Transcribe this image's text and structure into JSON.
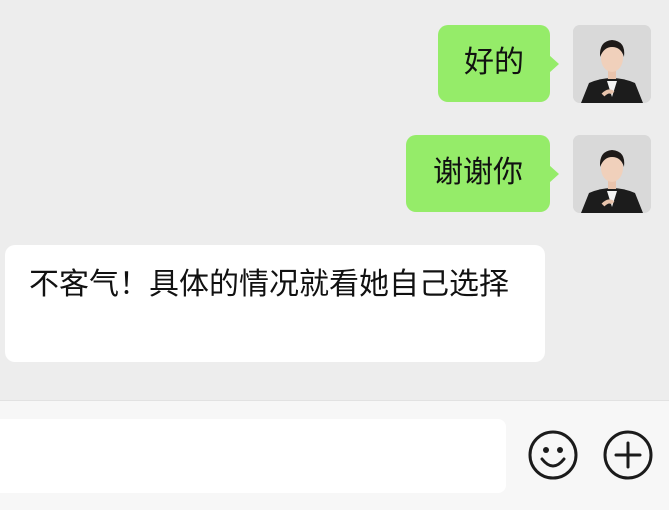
{
  "conversation": {
    "messages": [
      {
        "direction": "outgoing",
        "text": "好的"
      },
      {
        "direction": "outgoing",
        "text": "谢谢你"
      },
      {
        "direction": "incoming",
        "text": "不客气！具体的情况就看她自己选择"
      }
    ]
  },
  "input_bar": {
    "value": "",
    "placeholder": "",
    "emoji_icon": "smiley-icon",
    "more_icon": "plus-circle-icon"
  },
  "colors": {
    "chat_background": "#ededed",
    "outgoing_bubble": "#95ec69",
    "incoming_bubble": "#ffffff",
    "input_bar_background": "#f7f7f7",
    "icon_stroke": "#1b1b1b"
  }
}
